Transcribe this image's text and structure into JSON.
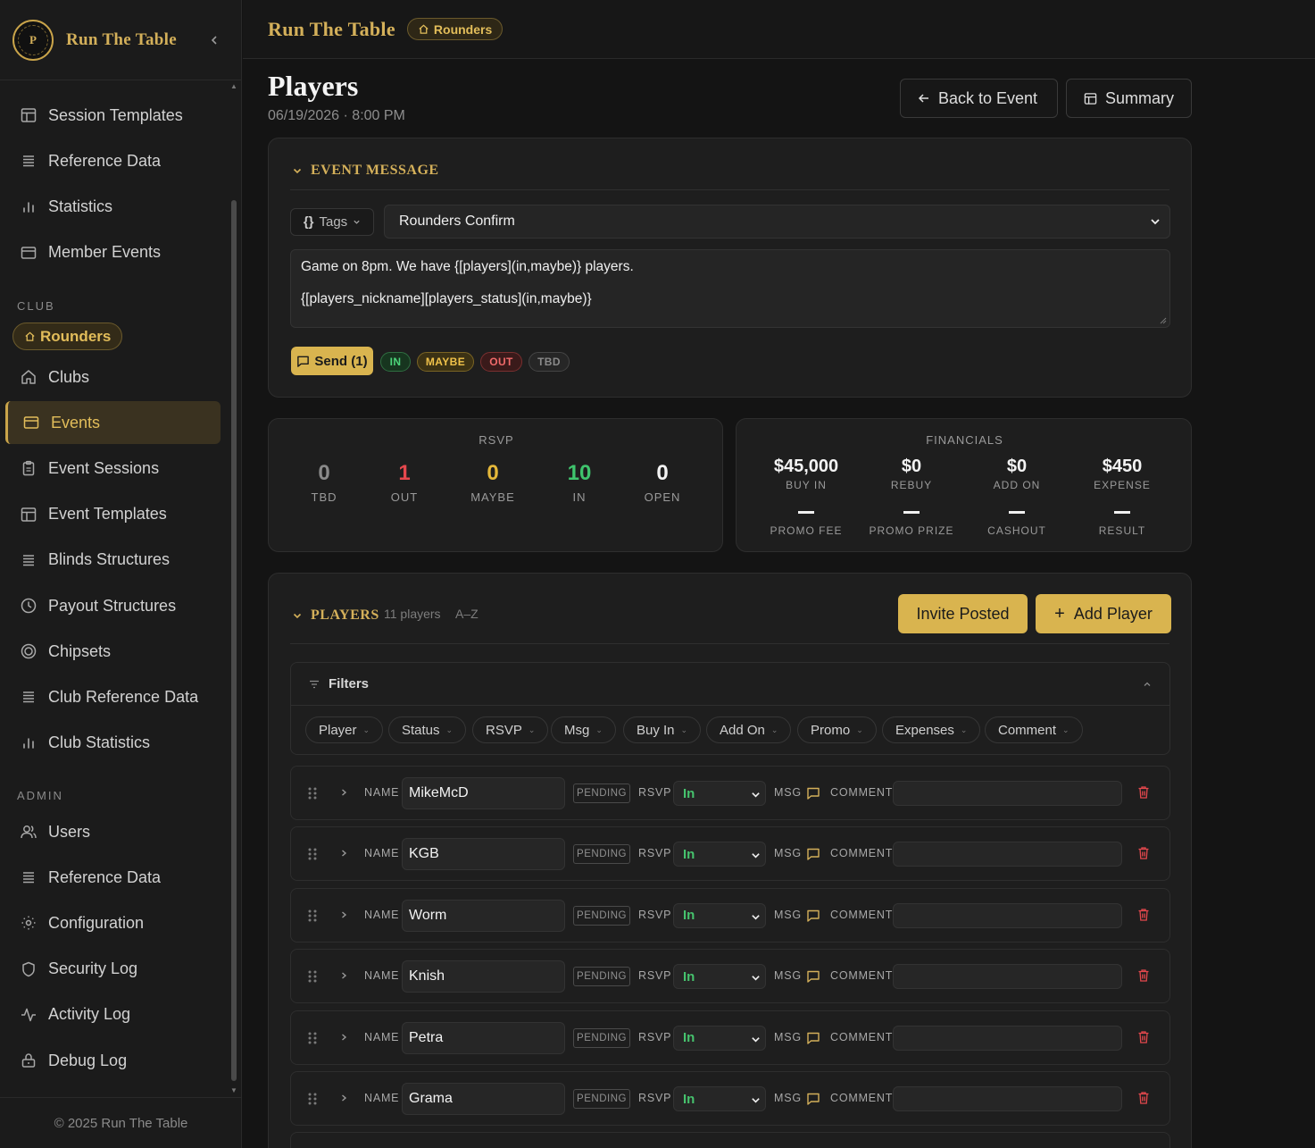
{
  "app": {
    "brand": "Run The Table",
    "logo_letter": "P",
    "footer": "© 2025 Run The Table"
  },
  "sidebar": {
    "items_top": [
      {
        "label": "Session Templates",
        "icon": "layout-template-icon"
      },
      {
        "label": "Reference Data",
        "icon": "list-icon"
      },
      {
        "label": "Statistics",
        "icon": "bar-chart-icon"
      },
      {
        "label": "Member Events",
        "icon": "calendar-card-icon"
      }
    ],
    "club_label": "CLUB",
    "club_pill": "Rounders",
    "club_items": [
      {
        "label": "Clubs",
        "icon": "home-icon"
      },
      {
        "label": "Events",
        "icon": "calendar-card-icon",
        "active": true
      },
      {
        "label": "Event Sessions",
        "icon": "clipboard-icon"
      },
      {
        "label": "Event Templates",
        "icon": "layout-template-icon"
      },
      {
        "label": "Blinds Structures",
        "icon": "list-icon"
      },
      {
        "label": "Payout Structures",
        "icon": "clock-icon"
      },
      {
        "label": "Chipsets",
        "icon": "chip-icon"
      },
      {
        "label": "Club Reference Data",
        "icon": "list-icon"
      },
      {
        "label": "Club Statistics",
        "icon": "bar-chart-icon"
      }
    ],
    "admin_label": "ADMIN",
    "admin_items": [
      {
        "label": "Users",
        "icon": "users-icon"
      },
      {
        "label": "Reference Data",
        "icon": "list-icon"
      },
      {
        "label": "Configuration",
        "icon": "sun-gear-icon"
      },
      {
        "label": "Security Log",
        "icon": "shield-icon"
      },
      {
        "label": "Activity Log",
        "icon": "activity-icon"
      },
      {
        "label": "Debug Log",
        "icon": "bug-icon"
      }
    ]
  },
  "topbar": {
    "title": "Run The Table",
    "badge": "Rounders"
  },
  "page": {
    "title": "Players",
    "subtitle": "06/19/2026 · 8:00 PM",
    "back_label": "Back to Event",
    "summary_label": "Summary"
  },
  "event_message": {
    "header": "EVENT MESSAGE",
    "tags_label": "Tags",
    "template_selected": "Rounders Confirm",
    "line1": "Game on 8pm. We have {[players](in,maybe)} players.",
    "line2": "{[players_nickname][players_status](in,maybe)}",
    "send_label": "Send (1)",
    "pills": [
      "IN",
      "MAYBE",
      "OUT",
      "TBD"
    ]
  },
  "rsvp": {
    "title": "RSVP",
    "stats": [
      {
        "value": "0",
        "label": "TBD",
        "color": "#8a8a8a"
      },
      {
        "value": "1",
        "label": "OUT",
        "color": "#e5484d"
      },
      {
        "value": "0",
        "label": "MAYBE",
        "color": "#e5b83a"
      },
      {
        "value": "10",
        "label": "IN",
        "color": "#3fc46d"
      },
      {
        "value": "0",
        "label": "OPEN",
        "color": "#f3f3f3"
      }
    ]
  },
  "financials": {
    "title": "FINANCIALS",
    "top": [
      {
        "value": "$45,000",
        "label": "BUY IN"
      },
      {
        "value": "$0",
        "label": "REBUY"
      },
      {
        "value": "$0",
        "label": "ADD ON"
      },
      {
        "value": "$450",
        "label": "EXPENSE"
      }
    ],
    "bottom": [
      {
        "label": "PROMO FEE"
      },
      {
        "label": "PROMO PRIZE"
      },
      {
        "label": "CASHOUT"
      },
      {
        "label": "RESULT"
      }
    ]
  },
  "players": {
    "header": "PLAYERS",
    "count": "11 players",
    "sort": "A–Z",
    "invite_label": "Invite Posted",
    "add_label": "Add Player",
    "filters_label": "Filters",
    "filter_chips": [
      "Player",
      "Status",
      "RSVP",
      "Msg",
      "Buy In",
      "Add On",
      "Promo",
      "Expenses",
      "Comment"
    ],
    "field_labels": {
      "name": "NAME",
      "status": "PENDING",
      "rsvp": "RSVP",
      "msg": "MSG",
      "comment": "COMMENT"
    },
    "rows": [
      {
        "name": "MikeMcD",
        "rsvp": "In"
      },
      {
        "name": "KGB",
        "rsvp": "In"
      },
      {
        "name": "Worm",
        "rsvp": "In"
      },
      {
        "name": "Knish",
        "rsvp": "In"
      },
      {
        "name": "Petra",
        "rsvp": "In"
      },
      {
        "name": "Grama",
        "rsvp": "In"
      }
    ]
  }
}
